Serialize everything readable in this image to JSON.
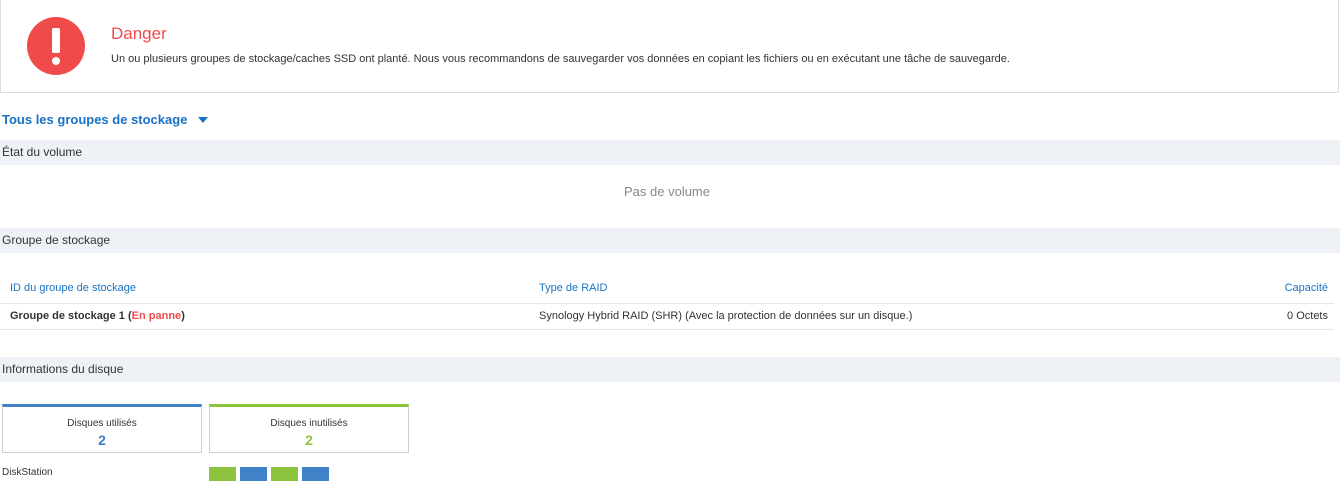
{
  "alert": {
    "title": "Danger",
    "message": "Un ou plusieurs groupes de stockage/caches SSD ont planté. Nous vous recommandons de sauvegarder vos données en copiant les fichiers ou en exécutant une tâche de sauvegarde.",
    "icon": "exclamation-icon",
    "color": "#f04b4b"
  },
  "selector": {
    "label": "Tous les groupes de stockage",
    "icon": "chevron-down-icon"
  },
  "volume_section": {
    "title": "État du volume",
    "empty_text": "Pas de volume"
  },
  "pool_section": {
    "title": "Groupe de stockage",
    "columns": [
      "ID du groupe de stockage",
      "Type de RAID",
      "Capacité"
    ],
    "rows": [
      {
        "name": "Groupe de stockage 1",
        "open": " (",
        "status": "En panne",
        "close": ")",
        "raid": "Synology Hybrid RAID (SHR) (Avec la protection de données sur un disque.)",
        "capacity": "0 Octets"
      }
    ]
  },
  "disk_section": {
    "title": "Informations du disque",
    "used": {
      "label": "Disques utilisés",
      "count": "2",
      "color": "#3f82c8"
    },
    "unused": {
      "label": "Disques inutilisés",
      "count": "2",
      "color": "#8cc43e"
    },
    "device_label": "DiskStation",
    "slots": [
      "unused",
      "used",
      "unused",
      "used"
    ]
  }
}
